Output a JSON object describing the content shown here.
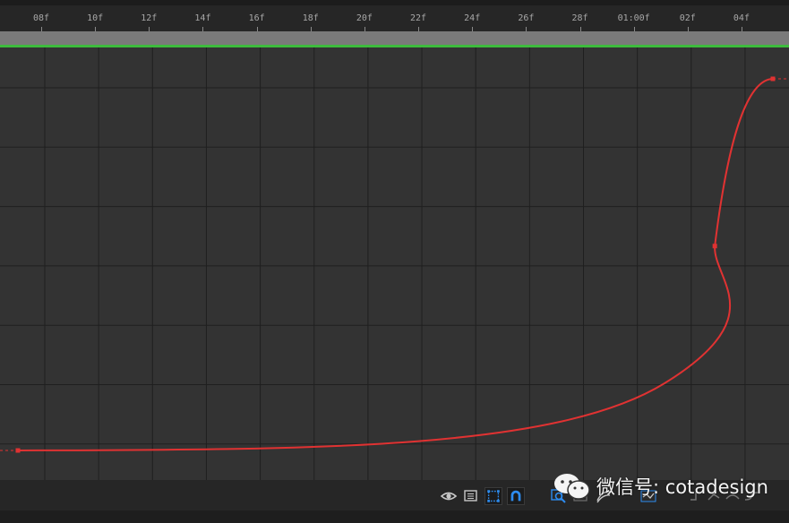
{
  "colors": {
    "graph_bg": "#333333",
    "grid": "#1f1f1f",
    "curve": "#e03232",
    "work_area": "#3dbb3d",
    "icon_blue": "#2d8cf0",
    "icon_gray": "#c8c8c8"
  },
  "ruler": {
    "labels": [
      "08f",
      "10f",
      "12f",
      "14f",
      "16f",
      "18f",
      "20f",
      "22f",
      "24f",
      "26f",
      "28f",
      "01:00f",
      "02f",
      "04f"
    ]
  },
  "graph": {
    "keyframes": [
      {
        "frame": 7,
        "value": 0
      },
      {
        "frame": 31,
        "value": 0.55
      },
      {
        "frame": 33,
        "value": 1
      }
    ],
    "frame_range": [
      7,
      34
    ]
  },
  "toolbar": {
    "icons": [
      {
        "name": "eye-icon",
        "active": false
      },
      {
        "name": "graph-list-icon",
        "active": false
      },
      {
        "name": "transform-box-icon",
        "active": true
      },
      {
        "name": "snap-magnet-icon",
        "active": true
      },
      {
        "name": "fit-selection-icon",
        "active": false
      },
      {
        "name": "fit-all-icon",
        "active": false
      },
      {
        "name": "separate-dimensions-icon",
        "active": false
      },
      {
        "name": "edit-keyframe-icon",
        "active": false
      },
      {
        "name": "hold-keyframe-icon",
        "active": false
      },
      {
        "name": "linear-keyframe-icon",
        "active": false
      },
      {
        "name": "auto-bezier-keyframe-icon",
        "active": false
      },
      {
        "name": "easy-ease-icon",
        "active": false
      }
    ]
  },
  "watermark": {
    "text": "微信号: cotadesign"
  }
}
